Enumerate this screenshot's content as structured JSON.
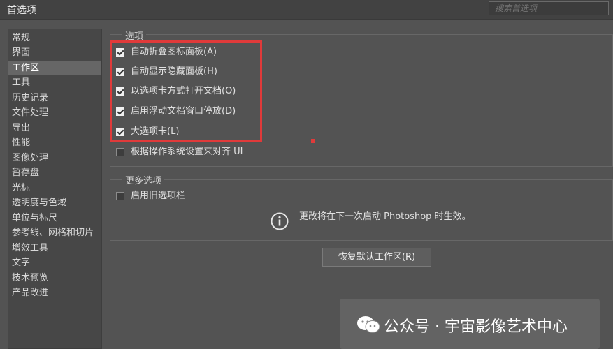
{
  "window": {
    "title": "首选项"
  },
  "search": {
    "placeholder": "搜索首选项"
  },
  "sidebar": {
    "items": [
      {
        "label": "常规"
      },
      {
        "label": "界面"
      },
      {
        "label": "工作区",
        "active": true
      },
      {
        "label": "工具"
      },
      {
        "label": "历史记录"
      },
      {
        "label": "文件处理"
      },
      {
        "label": "导出"
      },
      {
        "label": "性能"
      },
      {
        "label": "图像处理"
      },
      {
        "label": "暂存盘"
      },
      {
        "label": "光标"
      },
      {
        "label": "透明度与色域"
      },
      {
        "label": "单位与标尺"
      },
      {
        "label": "参考线、网格和切片"
      },
      {
        "label": "增效工具"
      },
      {
        "label": "文字"
      },
      {
        "label": "技术预览"
      },
      {
        "label": "产品改进"
      }
    ]
  },
  "options_group": {
    "title": "选项",
    "options": [
      {
        "label": "自动折叠图标面板(A)",
        "checked": true
      },
      {
        "label": "自动显示隐藏面板(H)",
        "checked": true
      },
      {
        "label": "以选项卡方式打开文档(O)",
        "checked": true
      },
      {
        "label": "启用浮动文档窗口停放(D)",
        "checked": true
      },
      {
        "label": "大选项卡(L)",
        "checked": true
      },
      {
        "label": "根据操作系统设置来对齐 UI",
        "checked": false
      }
    ]
  },
  "more_group": {
    "title": "更多选项",
    "options": [
      {
        "label": "启用旧选项栏",
        "checked": false
      }
    ],
    "notice": "更改将在下一次启动 Photoshop 时生效。"
  },
  "reset_button": {
    "label": "恢复默认工作区(R)"
  },
  "watermark": {
    "text": "公众号 · 宇宙影像艺术中心"
  },
  "colors": {
    "highlight": "#e03a3a",
    "panel": "#535353",
    "sidebar": "#474747",
    "selected": "#666666"
  }
}
